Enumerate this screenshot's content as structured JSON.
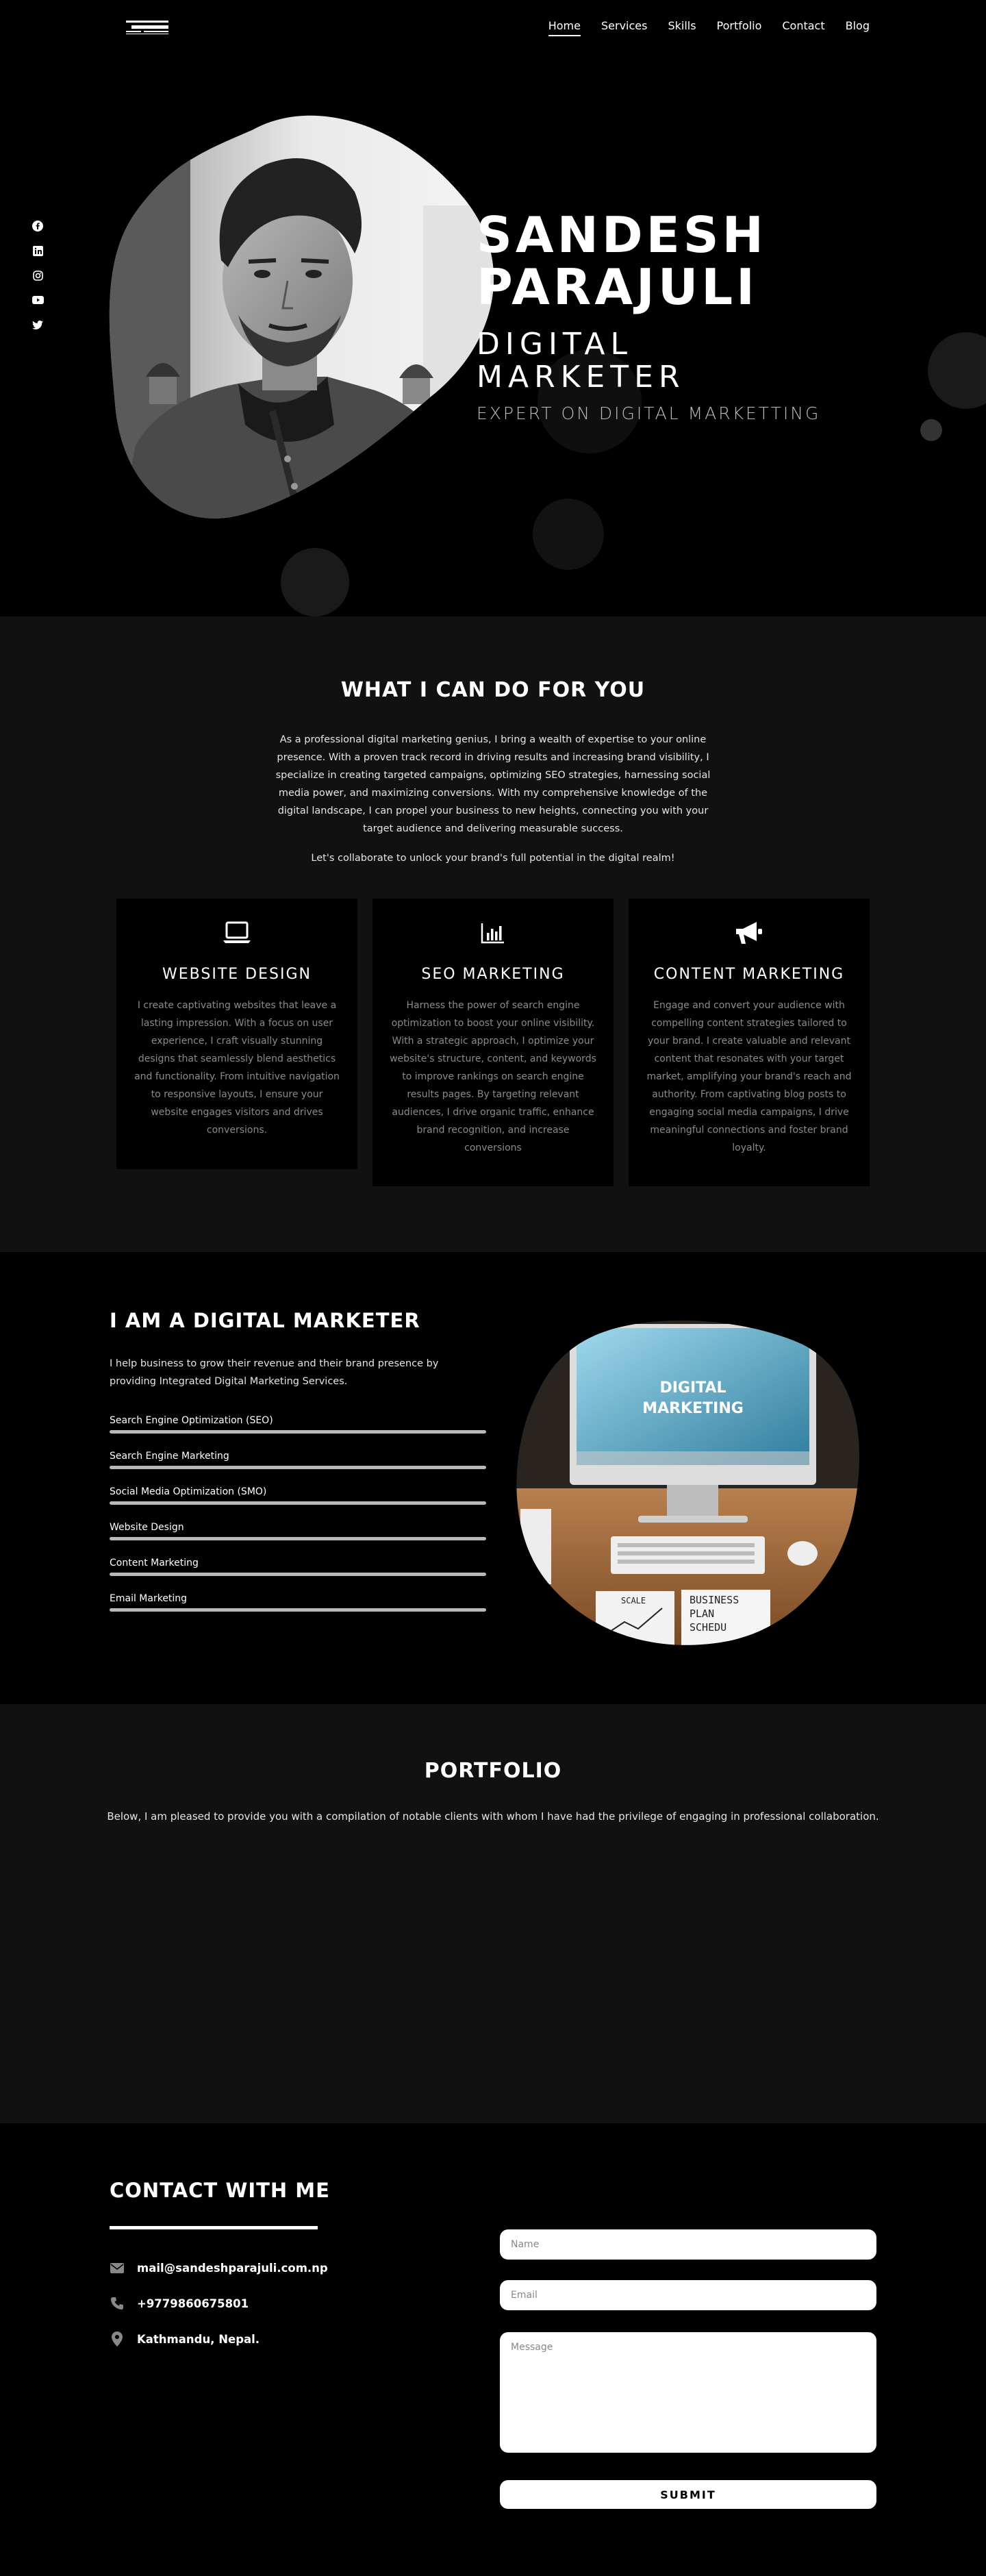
{
  "nav": {
    "logo_icon": "brand-logo",
    "items": [
      {
        "label": "Home",
        "active": true
      },
      {
        "label": "Services",
        "active": false
      },
      {
        "label": "Skills",
        "active": false
      },
      {
        "label": "Portfolio",
        "active": false
      },
      {
        "label": "Contact",
        "active": false
      },
      {
        "label": "Blog",
        "active": false
      }
    ]
  },
  "social": [
    "facebook-icon",
    "linkedin-icon",
    "instagram-icon",
    "youtube-icon",
    "twitter-icon"
  ],
  "hero": {
    "name_line1": "SANDESH",
    "name_line2": "PARAJULI",
    "role_line1": "DIGITAL",
    "role_line2": "MARKETER",
    "tagline": "EXPERT ON DIGITAL MARKETTING"
  },
  "services": {
    "title": "WHAT I CAN DO FOR YOU",
    "intro": "As a professional digital marketing genius, I bring a wealth of expertise to your online presence. With a proven track record in driving results and increasing brand visibility, I specialize in creating targeted campaigns, optimizing SEO strategies, harnessing social media power, and maximizing conversions. With my comprehensive knowledge of the digital landscape, I can propel your business to new heights, connecting you with your target audience and delivering measurable success.",
    "intro2": "Let's collaborate to unlock your brand's full potential in the digital realm!",
    "cards": [
      {
        "icon": "laptop-icon",
        "title": "WEBSITE DESIGN",
        "text": "I create captivating websites that leave a lasting impression. With a focus on user experience, I craft visually stunning designs that seamlessly blend aesthetics and functionality. From intuitive navigation to responsive layouts, I ensure your website engages visitors and drives conversions."
      },
      {
        "icon": "bar-chart-icon",
        "title": "SEO MARKETING",
        "text": "Harness the power of search engine optimization to boost your online visibility. With a strategic approach, I optimize your website's structure, content, and keywords to improve rankings on search engine results pages. By targeting relevant audiences, I drive organic traffic, enhance brand recognition, and increase conversions"
      },
      {
        "icon": "megaphone-icon",
        "title": "CONTENT MARKETING",
        "text": "Engage and convert your audience with compelling content strategies tailored to your brand. I create valuable and relevant content that resonates with your target market, amplifying your brand's reach and authority. From captivating blog posts to engaging social media campaigns, I drive meaningful connections and foster brand loyalty."
      }
    ]
  },
  "about": {
    "title": "I AM A DIGITAL MARKETER",
    "text": "I help business to grow their revenue and their brand presence by providing Integrated Digital Marketing Services.",
    "skills": [
      {
        "label": "Search Engine Optimization (SEO)",
        "level": 1.0
      },
      {
        "label": "Search Engine Marketing",
        "level": 1.0
      },
      {
        "label": "Social Media Optimization (SMO)",
        "level": 1.0
      },
      {
        "label": "Website Design",
        "level": 1.0
      },
      {
        "label": "Content Marketing",
        "level": 1.0
      },
      {
        "label": "Email Marketing",
        "level": 1.0
      }
    ],
    "image_text_line1": "DIGITAL",
    "image_text_line2": "MARKETING",
    "note_left": "SCALE",
    "note_right_line1": "BUSINESS",
    "note_right_line2": "PLAN",
    "note_right_line3": "SCHEDU"
  },
  "portfolio": {
    "title": "PORTFOLIO",
    "text": "Below, I am pleased to provide you with a compilation of notable clients with whom I have had the privilege of engaging in professional collaboration."
  },
  "contact": {
    "title": "CONTACT WITH ME",
    "email": "mail@sandeshparajuli.com.np",
    "phone": "+9779860675801",
    "address": "Kathmandu, Nepal.",
    "name_placeholder": "Name",
    "email_placeholder": "Email",
    "message_placeholder": "Message",
    "submit_label": "SUBMIT"
  }
}
